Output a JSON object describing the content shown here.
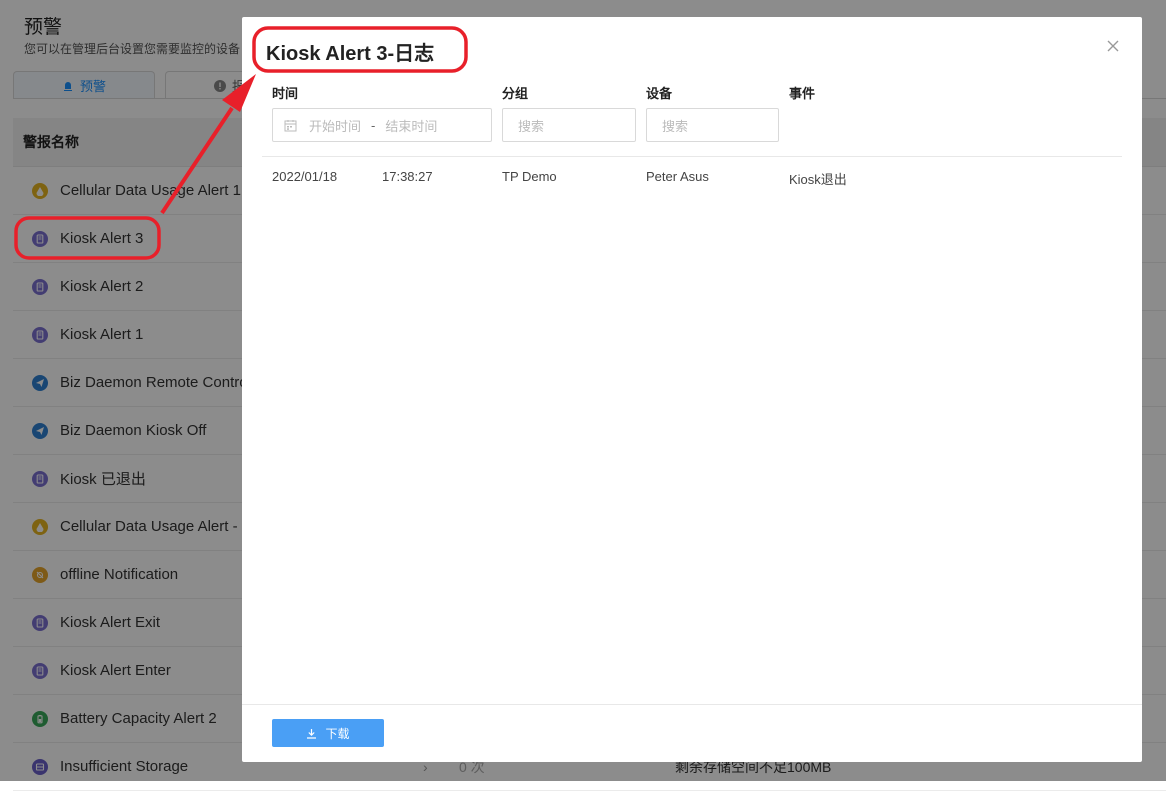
{
  "page": {
    "title": "预警",
    "subtitle": "您可以在管理后台设置您需要监控的设备",
    "tabs": [
      {
        "label": "预警",
        "icon": "bell-icon",
        "active": true
      },
      {
        "label": "报",
        "icon": "info-icon",
        "active": false
      }
    ],
    "list": {
      "header": "警报名称",
      "rows": [
        {
          "name": "Cellular Data Usage Alert 1",
          "icon": "data-usage-icon",
          "color": "#e6b422"
        },
        {
          "name": "Kiosk Alert 3",
          "icon": "kiosk-icon",
          "color": "#7b6fd0"
        },
        {
          "name": "Kiosk Alert 2",
          "icon": "kiosk-icon",
          "color": "#7b6fd0"
        },
        {
          "name": "Kiosk Alert 1",
          "icon": "kiosk-icon",
          "color": "#7b6fd0"
        },
        {
          "name": "Biz Daemon Remote Contro",
          "icon": "send-icon",
          "color": "#2f80d1"
        },
        {
          "name": "Biz Daemon Kiosk Off",
          "icon": "send-icon",
          "color": "#2f80d1"
        },
        {
          "name": "Kiosk 已退出",
          "icon": "kiosk-icon",
          "color": "#7b6fd0"
        },
        {
          "name": "Cellular Data Usage Alert -",
          "icon": "data-usage-icon",
          "color": "#e6b422"
        },
        {
          "name": "offline Notification",
          "icon": "offline-icon",
          "color": "#e6a52a"
        },
        {
          "name": "Kiosk Alert Exit",
          "icon": "kiosk-icon",
          "color": "#7b6fd0"
        },
        {
          "name": "Kiosk Alert Enter",
          "icon": "kiosk-icon",
          "color": "#7b6fd0"
        },
        {
          "name": "Battery Capacity Alert 2",
          "icon": "battery-icon",
          "color": "#3aa85a"
        },
        {
          "name": "Insufficient Storage",
          "icon": "storage-icon",
          "color": "#6a5fc8",
          "count": "0 次",
          "desc": "剩余存储空间不足100MB"
        }
      ]
    }
  },
  "modal": {
    "title": "Kiosk Alert 3-日志",
    "columns": {
      "time": "时间",
      "group": "分组",
      "device": "设备",
      "event": "事件"
    },
    "filters": {
      "start_placeholder": "开始时间",
      "separator": "-",
      "end_placeholder": "结束时间",
      "group_placeholder": "搜索",
      "device_placeholder": "搜索"
    },
    "rows": [
      {
        "date": "2022/01/18",
        "time": "17:38:27",
        "group": "TP Demo",
        "device": "Peter Asus",
        "event": "Kiosk退出"
      }
    ],
    "download_label": "下载"
  },
  "colors": {
    "accent": "#4a9ff5",
    "annotation": "#e8202a"
  }
}
